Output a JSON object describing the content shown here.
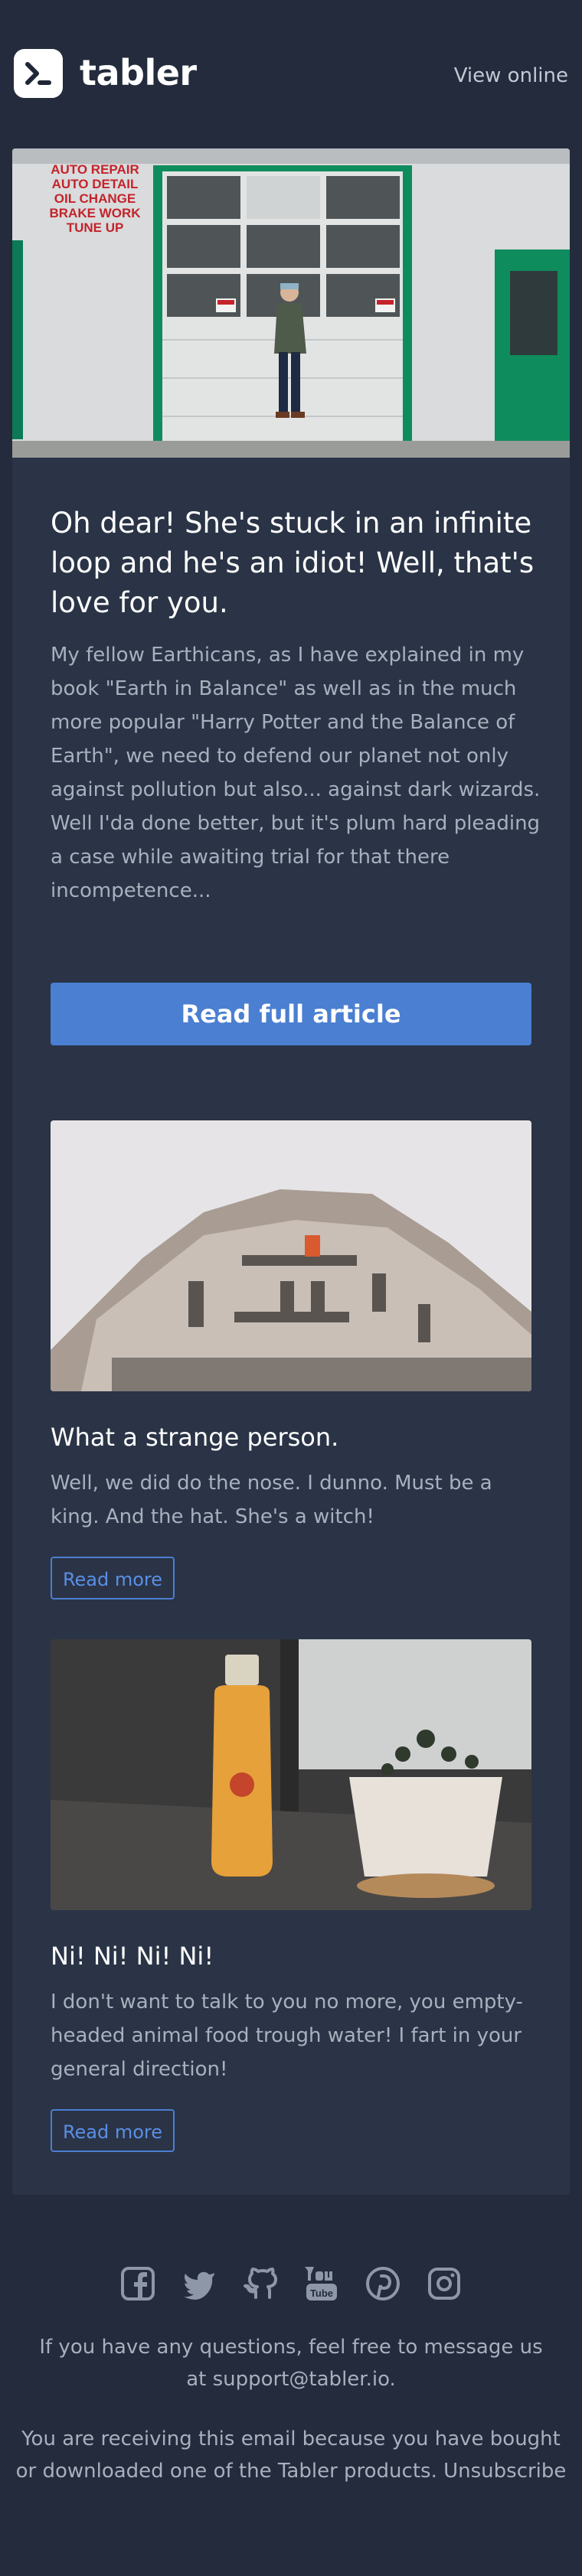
{
  "header": {
    "brand": "tabler",
    "view_online": "View online"
  },
  "hero": {
    "sign_lines": [
      "AUTO REPAIR",
      "AUTO DETAIL",
      "OIL CHANGE",
      "BRAKE WORK",
      "TUNE UP"
    ]
  },
  "article": {
    "headline": "Oh dear! She's stuck in an infinite loop and he's an idiot! Well, that's love for you.",
    "lead": "My fellow Earthicans, as I have explained in my book \"Earth in Balance\" as well as in the much more popular \"Harry Potter and the Balance of Earth\", we need to defend our planet not only against pollution but also... against dark wizards. Well I'da done better, but it's plum hard pleading a case while awaiting trial for that there incompetence...",
    "cta_label": "Read full article"
  },
  "posts": [
    {
      "title": "What a strange person.",
      "text": "Well, we did do the nose. I dunno. Must be a king. And the hat. She's a witch!",
      "button": "Read more"
    },
    {
      "title": "Ni! Ni! Ni! Ni!",
      "text": "I don't want to talk to you no more, you empty-headed animal food trough water! I fart in your general direction!",
      "button": "Read more"
    }
  ],
  "social": [
    "facebook-icon",
    "twitter-icon",
    "github-icon",
    "youtube-icon",
    "pinterest-icon",
    "instagram-icon"
  ],
  "footer": {
    "questions_text": "If you have any questions, feel free to message us at",
    "support_email": "support@tabler.io.",
    "receiving_text": "You are receiving this email because you have bought or downloaded one of the Tabler products.",
    "unsubscribe": "Unsubscribe"
  },
  "colors": {
    "background": "#232b3c",
    "card": "#2a3446",
    "accent": "#4a7fd1"
  }
}
